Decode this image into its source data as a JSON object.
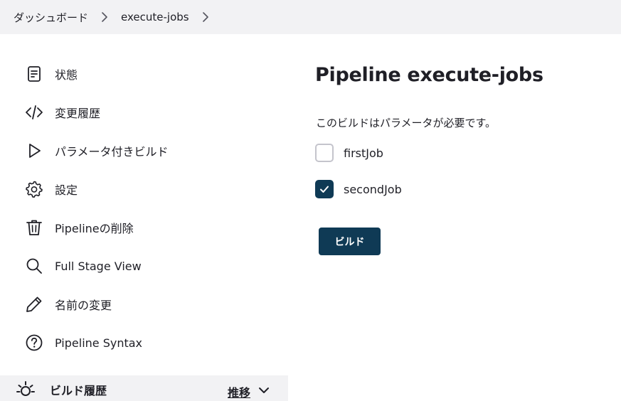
{
  "breadcrumb": {
    "items": [
      {
        "label": "ダッシュボード"
      },
      {
        "label": "execute-jobs"
      }
    ]
  },
  "sidebar": {
    "tasks": [
      {
        "label": "状態",
        "icon": "document-icon"
      },
      {
        "label": "変更履歴",
        "icon": "code-icon"
      },
      {
        "label": "パラメータ付きビルド",
        "icon": "play-icon"
      },
      {
        "label": "設定",
        "icon": "gear-icon"
      },
      {
        "label": "Pipelineの削除",
        "icon": "trash-icon"
      },
      {
        "label": "Full Stage View",
        "icon": "search-icon"
      },
      {
        "label": "名前の変更",
        "icon": "pencil-icon"
      },
      {
        "label": "Pipeline Syntax",
        "icon": "help-icon"
      }
    ],
    "history": {
      "title": "ビルド履歴",
      "trend_label": "推移"
    }
  },
  "main": {
    "title": "Pipeline execute-jobs",
    "description": "このビルドはパラメータが必要です。",
    "parameters": [
      {
        "label": "firstJob",
        "checked": false
      },
      {
        "label": "secondJob",
        "checked": true
      }
    ],
    "build_button": "ビルド"
  },
  "colors": {
    "accent": "#0f3a55",
    "breadcrumb_bg": "#f2f2f4",
    "text": "#1f1f26"
  }
}
